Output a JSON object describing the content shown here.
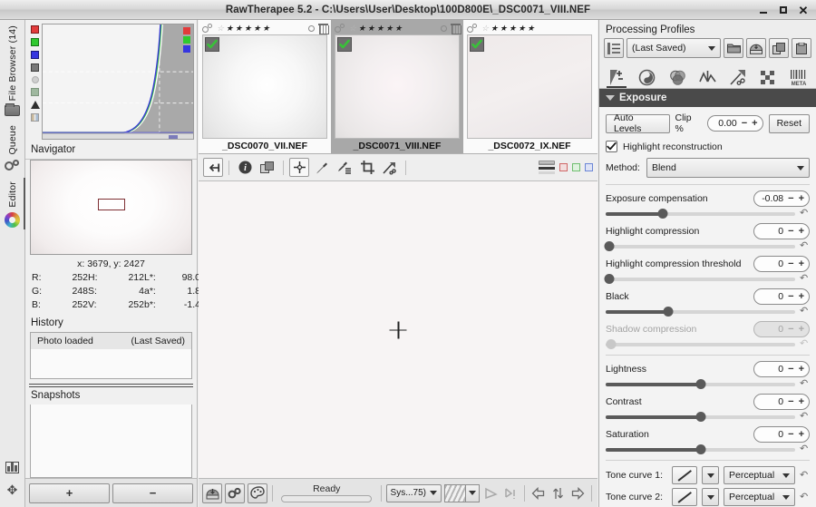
{
  "window": {
    "title": "RawTherapee 5.2 - C:\\Users\\User\\Desktop\\100D800E\\_DSC0071_VIII.NEF",
    "minimize_label": "Minimize",
    "maximize_label": "Maximize",
    "close_label": "Close"
  },
  "vertical_tabs": [
    {
      "label": "File Browser (14)",
      "icon": "folder-icon",
      "active": false
    },
    {
      "label": "Queue",
      "icon": "gears-icon",
      "active": false
    },
    {
      "label": "Editor",
      "icon": "color-wheel-icon",
      "active": true
    }
  ],
  "histogram": {
    "toggles": [
      {
        "name": "red-channel",
        "color": "#e23b3b"
      },
      {
        "name": "green-channel",
        "color": "#2fc92f"
      },
      {
        "name": "blue-channel",
        "color": "#3636e0"
      },
      {
        "name": "luminance",
        "color": "#787878"
      },
      {
        "name": "chromaticity",
        "color": "#cfcfcf"
      },
      {
        "name": "raw",
        "color": "#9fb89f"
      },
      {
        "name": "clipping-indicator",
        "color": "#2e2e2e"
      },
      {
        "name": "bar-mode",
        "color": "#c9b89a"
      }
    ]
  },
  "navigator": {
    "title": "Navigator",
    "coords": "x: 3679, y: 2427",
    "values": [
      {
        "key": "R:",
        "value": "252",
        "key2": "H:",
        "value2": "212",
        "key3": "L*:",
        "value3": "98.0"
      },
      {
        "key": "G:",
        "value": "248",
        "key2": "S:",
        "value2": "4",
        "key3": "a*:",
        "value3": "1.8"
      },
      {
        "key": "B:",
        "value": "252",
        "key2": "V:",
        "value2": "252",
        "key3": "b*:",
        "value3": "-1.4"
      }
    ]
  },
  "history": {
    "title": "History",
    "rows": [
      {
        "label": "Photo loaded",
        "state": "(Last Saved)"
      }
    ]
  },
  "snapshots": {
    "title": "Snapshots",
    "add_label": "+",
    "remove_label": "−"
  },
  "filmstrip": {
    "thumbnails": [
      {
        "filename": "_DSC0070_VII.NEF",
        "rating": 0,
        "stars_total": 5,
        "selected": false,
        "checked": true
      },
      {
        "filename": "_DSC0071_VIII.NEF",
        "rating": 0,
        "stars_total": 5,
        "selected": true,
        "checked": true
      },
      {
        "filename": "_DSC0072_IX.NEF",
        "rating": 0,
        "stars_total": 5,
        "selected": false,
        "checked": true
      }
    ]
  },
  "editor_toolbar": {
    "buttons": [
      {
        "name": "back-to-browser-button",
        "icon": "arrow-to-bar-icon",
        "framed": true
      },
      {
        "name": "info-button",
        "icon": "info-icon",
        "framed": false
      },
      {
        "name": "before-after-button",
        "icon": "before-after-icon",
        "framed": false
      },
      {
        "name": "white-balance-picker-button",
        "icon": "crosshair-picker-icon",
        "framed": true
      },
      {
        "name": "spot-wb-button",
        "icon": "eyedropper-icon",
        "framed": false
      },
      {
        "name": "lockable-color-picker-button",
        "icon": "eyedropper-list-icon",
        "framed": false
      },
      {
        "name": "crop-button",
        "icon": "crop-icon",
        "framed": false
      },
      {
        "name": "straighten-button",
        "icon": "straighten-icon",
        "framed": false
      }
    ],
    "indicators": [
      {
        "name": "clipping-indicator-r",
        "color": "#d06767"
      },
      {
        "name": "clipping-indicator-g",
        "color": "#6fbe6f"
      },
      {
        "name": "clipping-indicator-b",
        "color": "#6b86d6"
      }
    ]
  },
  "statusbar": {
    "status_text": "Ready",
    "progress_percent": 0,
    "zoom_label": "Sys...75)",
    "buttons": [
      {
        "name": "save-button",
        "icon": "save-icon"
      },
      {
        "name": "queue-button",
        "icon": "gears-icon"
      },
      {
        "name": "send-to-editor-button",
        "icon": "palette-icon"
      },
      {
        "name": "rotate-left-button",
        "icon": "rotate-left-icon"
      },
      {
        "name": "rotate-right-button",
        "icon": "rotate-right-icon"
      },
      {
        "name": "previous-image-button",
        "icon": "arrow-left-icon"
      },
      {
        "name": "sync-button",
        "icon": "arrows-updown-icon"
      },
      {
        "name": "next-image-button",
        "icon": "arrow-right-icon"
      }
    ]
  },
  "processing_profiles": {
    "title": "Processing Profiles",
    "selected_profile": "(Last Saved)",
    "buttons": [
      {
        "name": "load-profile-button",
        "icon": "folder-icon"
      },
      {
        "name": "save-profile-button",
        "icon": "save-icon"
      },
      {
        "name": "copy-profile-button",
        "icon": "copy-icon"
      },
      {
        "name": "paste-profile-button",
        "icon": "paste-icon"
      }
    ]
  },
  "tool_tabs": [
    {
      "name": "tab-exposure",
      "icon": "exposure-icon",
      "active": true
    },
    {
      "name": "tab-detail",
      "icon": "detail-icon",
      "active": false
    },
    {
      "name": "tab-color",
      "icon": "color-icon",
      "active": false
    },
    {
      "name": "tab-advanced",
      "icon": "wavelet-icon",
      "active": false
    },
    {
      "name": "tab-transform",
      "icon": "transform-icon",
      "active": false
    },
    {
      "name": "tab-raw",
      "icon": "raw-icon",
      "active": false
    },
    {
      "name": "tab-metadata",
      "icon": "meta-icon",
      "active": false,
      "label": "META"
    }
  ],
  "exposure": {
    "header": "Exposure",
    "auto_levels_label": "Auto Levels",
    "clip_label": "Clip %",
    "clip_value": "0.00",
    "reset_label": "Reset",
    "highlight_reconstruction_label": "Highlight reconstruction",
    "highlight_reconstruction_checked": true,
    "method_label": "Method:",
    "method_value": "Blend",
    "sliders": [
      {
        "name": "exposure-compensation",
        "label": "Exposure compensation",
        "value": "-0.08",
        "knob_percent": 30,
        "disabled": false
      },
      {
        "name": "highlight-compression",
        "label": "Highlight compression",
        "value": "0",
        "knob_percent": 2,
        "disabled": false
      },
      {
        "name": "highlight-compression-threshold",
        "label": "Highlight compression threshold",
        "value": "0",
        "knob_percent": 2,
        "disabled": false
      },
      {
        "name": "black",
        "label": "Black",
        "value": "0",
        "knob_percent": 33,
        "disabled": false
      },
      {
        "name": "shadow-compression",
        "label": "Shadow compression",
        "value": "0",
        "knob_percent": 3,
        "disabled": true
      },
      {
        "name": "lightness",
        "label": "Lightness",
        "value": "0",
        "knob_percent": 50,
        "disabled": false
      },
      {
        "name": "contrast",
        "label": "Contrast",
        "value": "0",
        "knob_percent": 50,
        "disabled": false
      },
      {
        "name": "saturation",
        "label": "Saturation",
        "value": "0",
        "knob_percent": 50,
        "disabled": false
      }
    ],
    "tone_curves": [
      {
        "name": "tone-curve-1",
        "label": "Tone curve 1:",
        "mode": "Perceptual"
      },
      {
        "name": "tone-curve-2",
        "label": "Tone curve 2:",
        "mode": "Perceptual"
      }
    ]
  }
}
